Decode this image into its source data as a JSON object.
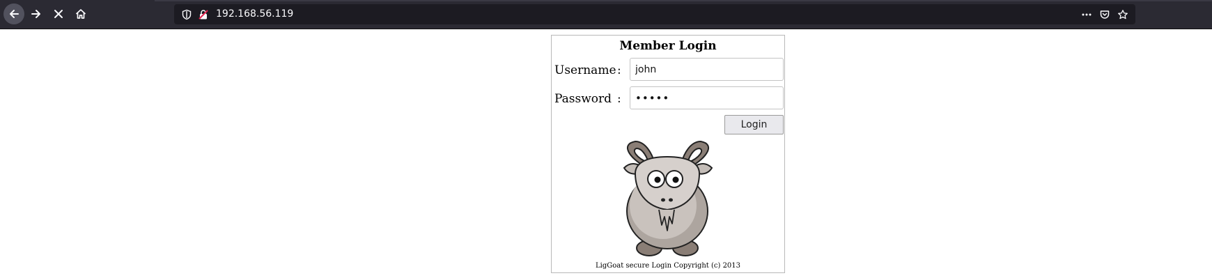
{
  "browser": {
    "url": "192.168.56.119",
    "icons": {
      "back": "arrow-left-icon",
      "forward": "arrow-right-icon",
      "stop": "close-icon",
      "home": "home-icon",
      "tracking": "shield-icon",
      "insecure": "insecure-lock-icon",
      "more": "more-dots-icon",
      "pocket": "pocket-icon",
      "bookmark": "star-icon"
    },
    "colors": {
      "toolbar": "#2b2a33",
      "urlbar": "#1c1b22",
      "text": "#fbfbfe",
      "insecure": "#e22850"
    }
  },
  "login": {
    "title": "Member Login",
    "username_label": "Username",
    "password_label": "Password",
    "colon": ":",
    "username_value": "john",
    "password_value": "•••••",
    "button_label": "Login",
    "image": "goat-illustration",
    "copyright": "LigGoat secure Login Copyright (c) 2013"
  }
}
